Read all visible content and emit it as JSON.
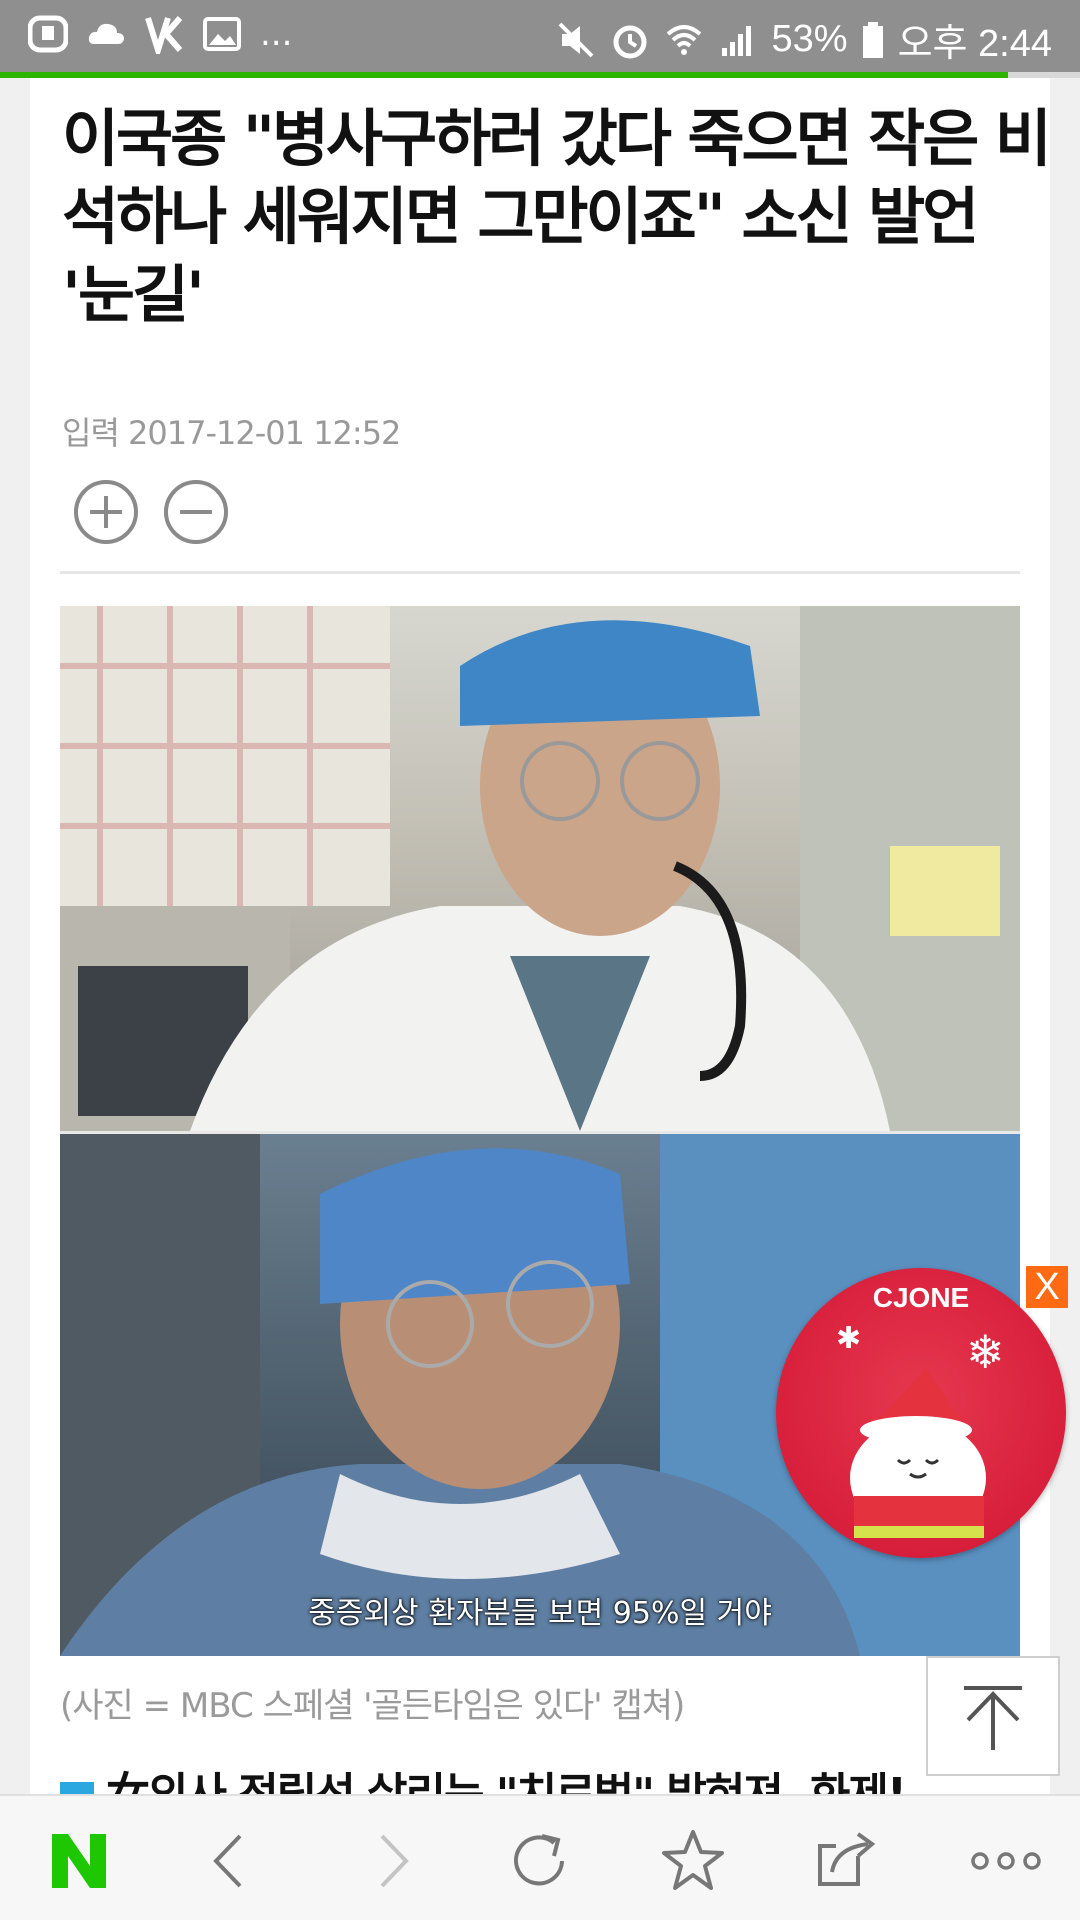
{
  "status_bar": {
    "more": "...",
    "battery": "53%",
    "time": "오후 2:44"
  },
  "article": {
    "headline": "이국종 \"병사구하러 갔다 죽으면 작은 비석하나 세워지면 그만이죠\" 소신 발언 '눈길'",
    "date": "입력 2017-12-01 12:52",
    "photo_subtitle": "중증외상 환자분들 보면 95%일 거야",
    "photo_caption": "(사진 = MBC 스페셜 '골든타임은 있다' 캡쳐)",
    "related_link": "女의사 전립선 살리는 \"치료법\" 발혀져, 화제!"
  },
  "ad": {
    "brand": "CJONE",
    "close_label": "X"
  },
  "colors": {
    "accent_green": "#2db400",
    "ad_red": "#d81f3b",
    "ad_close": "#ff6a13"
  },
  "bottom_nav": {
    "icons": [
      "naver-logo-icon",
      "back-icon",
      "forward-icon",
      "refresh-icon",
      "bookmark-star-icon",
      "share-icon",
      "more-icon"
    ]
  }
}
